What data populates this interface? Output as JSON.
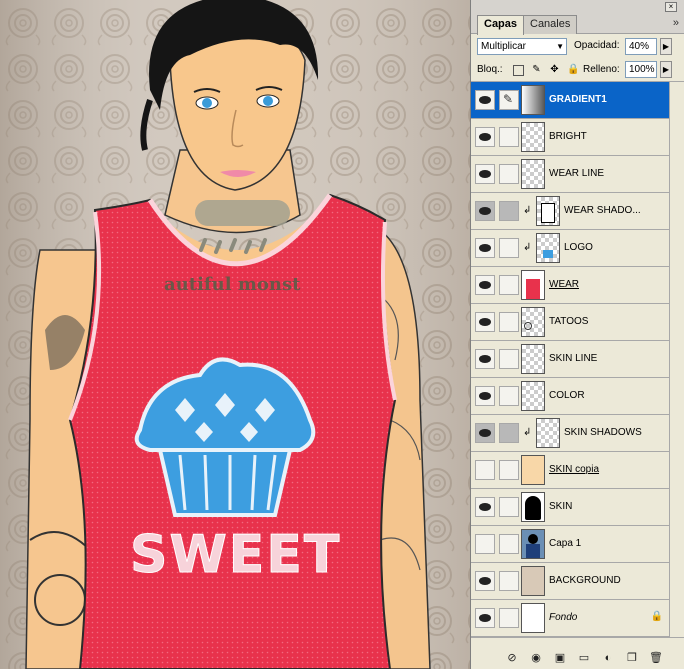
{
  "canvas": {
    "shirt_text": "SWEET",
    "tattoo_text": "autiful monst"
  },
  "panel": {
    "tabs": [
      {
        "label": "Capas",
        "active": true
      },
      {
        "label": "Canales",
        "active": false
      }
    ],
    "blend_mode": "Multiplicar",
    "opacity_label": "Opacidad:",
    "opacity_value": "40%",
    "lock_label": "Bloq.:",
    "fill_label": "Relleno:",
    "fill_value": "100%",
    "menu_icon": "double-chevron-right-icon"
  },
  "layers": [
    {
      "name": "GRADIENT1",
      "visible": true,
      "selected": true,
      "thumb": "gradient",
      "style": "bold"
    },
    {
      "name": "BRIGHT",
      "visible": true,
      "thumb": "checker"
    },
    {
      "name": "WEAR LINE",
      "visible": true,
      "thumb": "checker"
    },
    {
      "name": "WEAR SHADO...",
      "visible": true,
      "clipped": true,
      "thumb": "shirt-outline",
      "grey": true
    },
    {
      "name": "LOGO",
      "visible": true,
      "clipped": true,
      "thumb": "checker-blue"
    },
    {
      "name": "WEAR",
      "visible": true,
      "thumb": "red-shirt",
      "style": "under"
    },
    {
      "name": "TATOOS",
      "visible": true,
      "thumb": "tattoo"
    },
    {
      "name": "SKIN LINE",
      "visible": true,
      "thumb": "checker"
    },
    {
      "name": "COLOR",
      "visible": true,
      "thumb": "checker"
    },
    {
      "name": "SKIN SHADOWS",
      "visible": true,
      "clipped": true,
      "thumb": "checker-skin",
      "grey": true
    },
    {
      "name": "SKIN copia",
      "visible": false,
      "thumb": "skin",
      "style": "under"
    },
    {
      "name": "SKIN",
      "visible": true,
      "thumb": "black-figure"
    },
    {
      "name": "Capa 1",
      "visible": false,
      "thumb": "photo"
    },
    {
      "name": "BACKGROUND",
      "visible": true,
      "thumb": "roses"
    },
    {
      "name": "Fondo",
      "visible": true,
      "thumb": "white",
      "style": "italic",
      "locked": true
    }
  ],
  "colors": {
    "selection": "#0a64c8",
    "shirt_red": "#e8324c",
    "skin": "#f8c78c",
    "cupcake_blue": "#3d9ee0"
  }
}
